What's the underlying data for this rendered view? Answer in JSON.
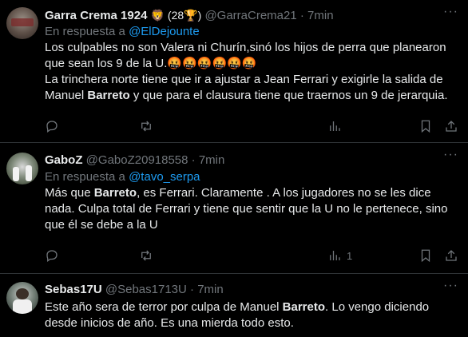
{
  "tweets": [
    {
      "name": "Garra Crema 1924",
      "badge": "🦁 (28🏆)",
      "handle": "@GarraCrema21",
      "dot": "·",
      "time": "7min",
      "reply_prefix": "En respuesta a",
      "reply_to": "@ElDejounte",
      "text_parts": [
        "Los culpables no son Valera ni Churín,sinó los hijos de perra que planearon que sean los 9 de la U.🤬🤬🤬🤬🤬🤬\nLa trinchera norte tiene que ir a ajustar a Jean Ferrari y exigirle la salida de Manuel ",
        "Barreto",
        " y que para el clausura tiene que traernos un 9 de jerarquia."
      ],
      "views_count": ""
    },
    {
      "name": "GaboZ",
      "badge": "",
      "handle": "@GaboZ20918558",
      "dot": "·",
      "time": "7min",
      "reply_prefix": "En respuesta a",
      "reply_to": "@tavo_serpa",
      "text_parts": [
        "Más que ",
        "Barreto",
        ", es Ferrari. Claramente . A los jugadores no se les dice nada. Culpa total de Ferrari y tiene que sentir que la U no le pertenece, sino que él se debe a la U"
      ],
      "views_count": "1"
    },
    {
      "name": "Sebas17U",
      "badge": "",
      "handle": "@Sebas1713U",
      "dot": "·",
      "time": "7min",
      "reply_prefix": "",
      "reply_to": "",
      "text_parts": [
        "Este año sera de terror por culpa de Manuel ",
        "Barreto",
        ". Lo vengo diciendo desde inicios de año. Es una mierda todo esto."
      ],
      "views_count": ""
    }
  ],
  "more_label": "···",
  "icons": [
    "reply-icon",
    "retweet-icon",
    "like-icon",
    "views-icon",
    "bookmark-icon",
    "share-icon"
  ],
  "colors": {
    "background": "#000000",
    "text": "#e7e9ea",
    "muted": "#71767b",
    "link": "#1d9bf0",
    "divider": "#2f3336"
  }
}
